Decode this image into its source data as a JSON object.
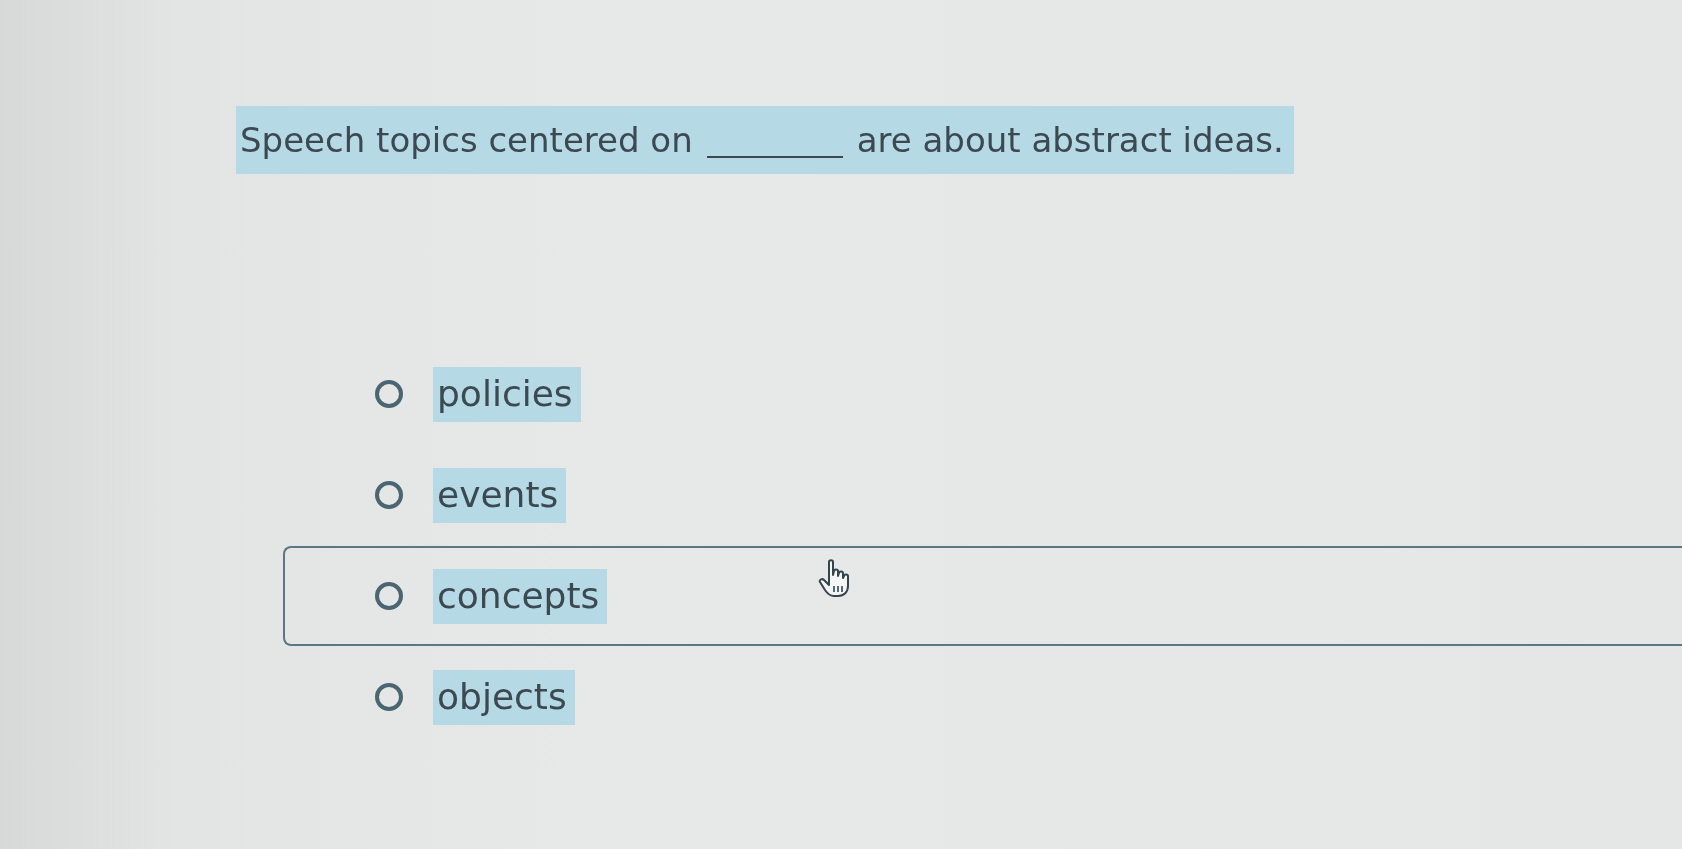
{
  "question": {
    "before": "Speech topics centered on",
    "after": "are about abstract ideas.",
    "highlighted": true
  },
  "options": [
    {
      "label": "policies",
      "selected": false,
      "hovered": false,
      "highlighted": true
    },
    {
      "label": "events",
      "selected": false,
      "hovered": false,
      "highlighted": true
    },
    {
      "label": "concepts",
      "selected": false,
      "hovered": true,
      "highlighted": true
    },
    {
      "label": "objects",
      "selected": false,
      "hovered": false,
      "highlighted": true
    }
  ]
}
